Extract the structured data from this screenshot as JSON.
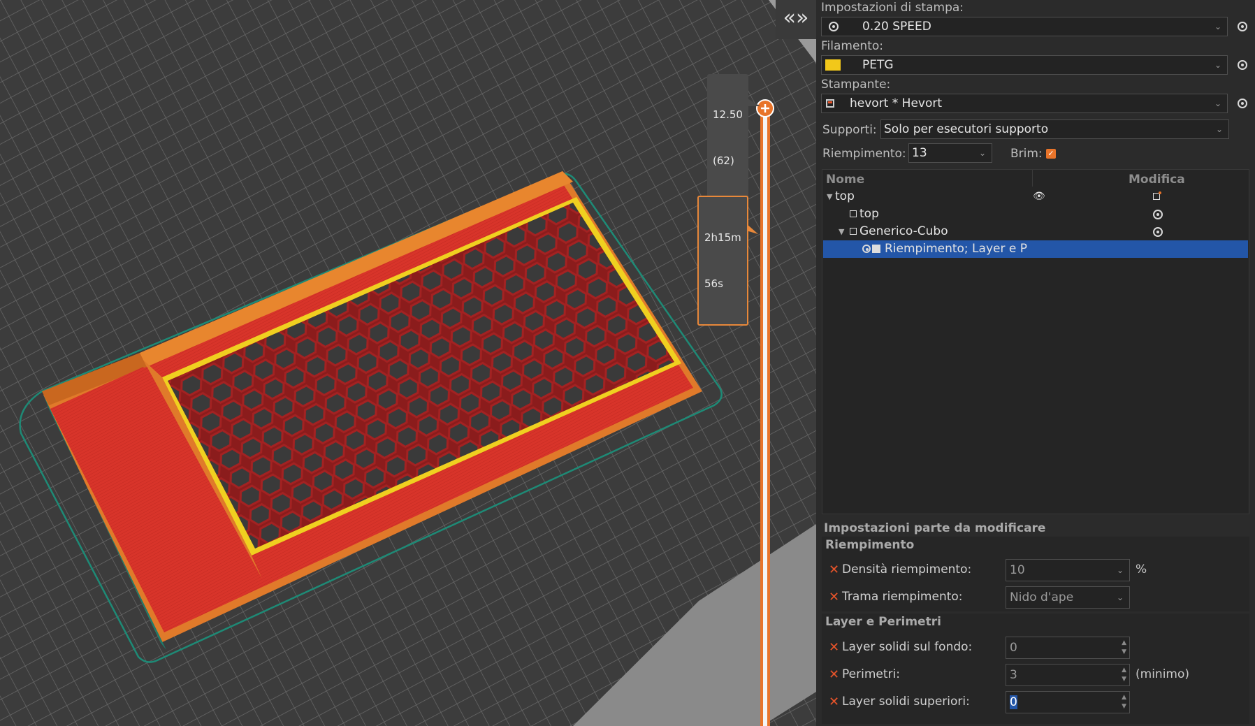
{
  "viewport": {
    "collapse_label": "«»",
    "layer_height": "12.50",
    "layer_number": "(62)",
    "time_line1": "2h15m",
    "time_line2": "56s"
  },
  "panel": {
    "print_settings_label": "Impostazioni di stampa:",
    "print_settings_value": "0.20 SPEED",
    "filament_label": "Filamento:",
    "filament_value": "PETG",
    "filament_color": "#f2c81a",
    "printer_label": "Stampante:",
    "printer_value": "hevort * Hevort",
    "supports_label": "Supporti:",
    "supports_value": "Solo per esecutori supporto",
    "infill_label": "Riempimento:",
    "infill_value": "13",
    "brim_label": "Brim:",
    "brim_checked": true
  },
  "tree": {
    "col_name": "Nome",
    "col_edit": "Modifica",
    "rows": [
      {
        "label": "top"
      },
      {
        "label": "top"
      },
      {
        "label": "Generico-Cubo"
      },
      {
        "label": "Riempimento; Layer e P"
      }
    ]
  },
  "modifier": {
    "title": "Impostazioni parte da modificare",
    "group_infill": "Riempimento",
    "infill_density_label": "Densità riempimento:",
    "infill_density_value": "10",
    "infill_density_unit": "%",
    "infill_pattern_label": "Trama riempimento:",
    "infill_pattern_value": "Nido d'ape",
    "group_layers": "Layer e Perimetri",
    "bottom_layers_label": "Layer solidi sul fondo:",
    "bottom_layers_value": "0",
    "perimeters_label": "Perimetri:",
    "perimeters_value": "3",
    "perimeters_unit": "(minimo)",
    "top_layers_label": "Layer solidi superiori:",
    "top_layers_value": "0"
  }
}
